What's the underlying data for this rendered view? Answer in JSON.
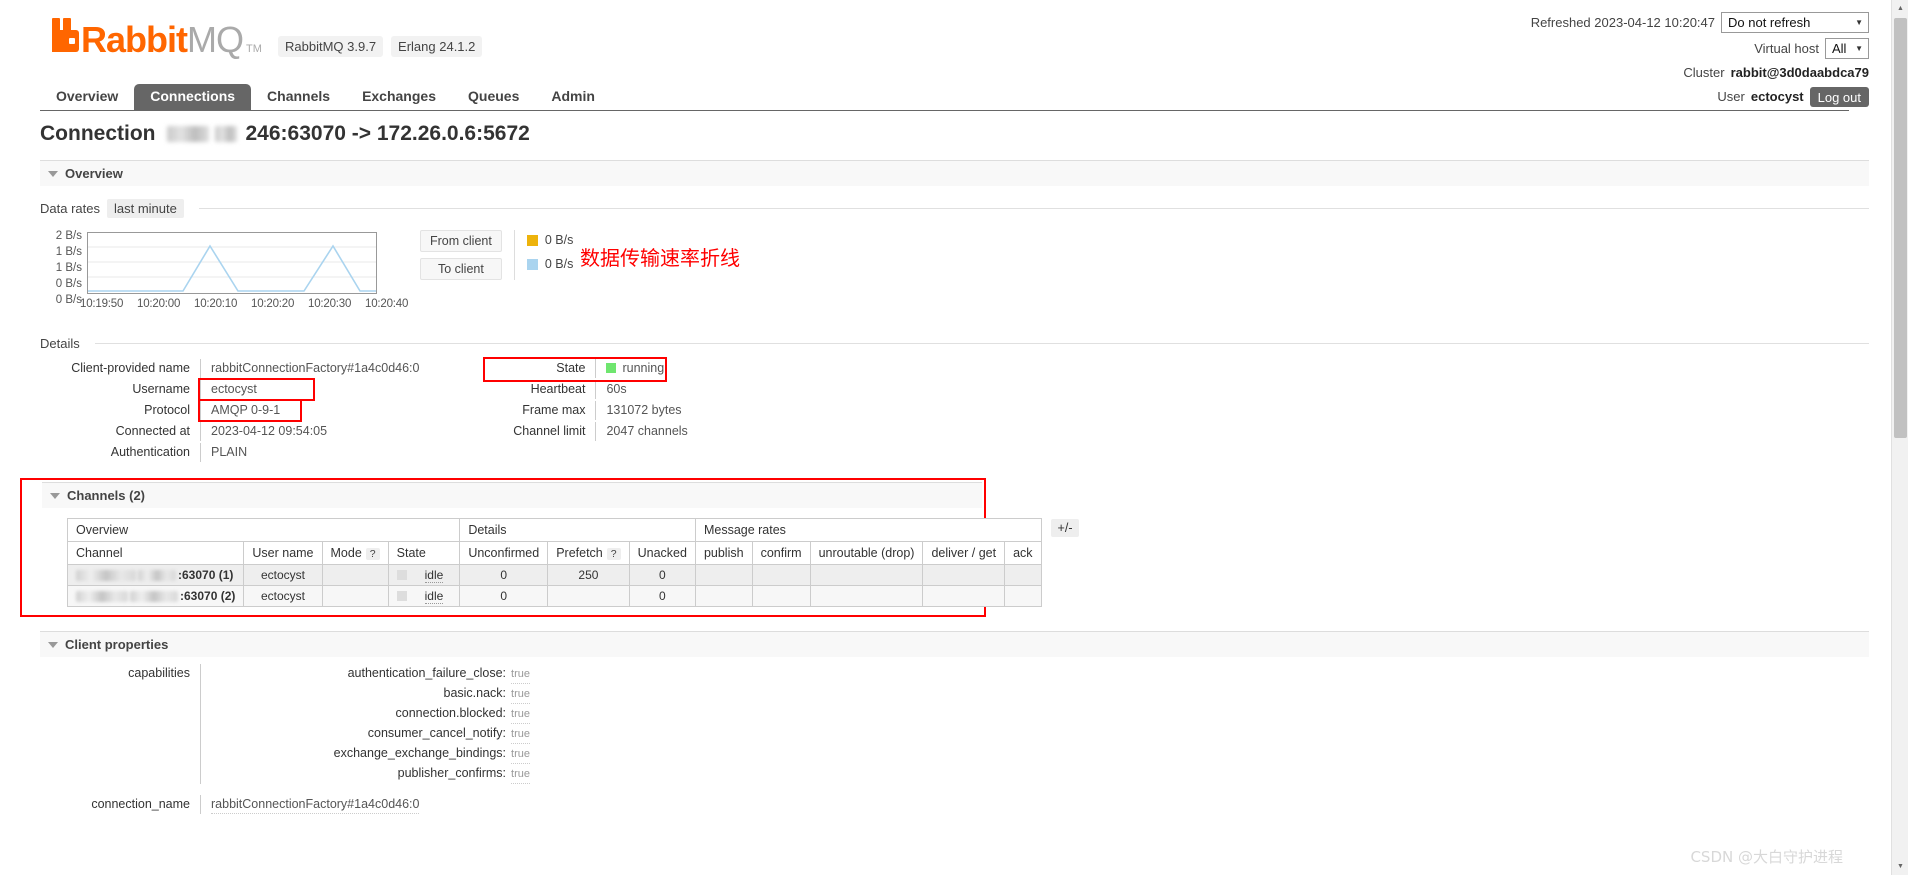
{
  "header": {
    "logo_rabbit": "Rabbit",
    "logo_mq": "MQ",
    "logo_tm": "TM",
    "version_rabbitmq": "RabbitMQ 3.9.7",
    "version_erlang": "Erlang 24.1.2",
    "refreshed_label": "Refreshed 2023-04-12 10:20:47",
    "refresh_option": "Do not refresh",
    "vhost_label": "Virtual host",
    "vhost_value": "All",
    "cluster_label": "Cluster",
    "cluster_value": "rabbit@3d0daabdca79",
    "user_label": "User",
    "user_value": "ectocyst",
    "logout_label": "Log out"
  },
  "nav": {
    "tabs": [
      {
        "label": "Overview",
        "active": false
      },
      {
        "label": "Connections",
        "active": true
      },
      {
        "label": "Channels",
        "active": false
      },
      {
        "label": "Exchanges",
        "active": false
      },
      {
        "label": "Queues",
        "active": false
      },
      {
        "label": "Admin",
        "active": false
      }
    ]
  },
  "page": {
    "title_prefix": "Connection",
    "title_suffix": "246:63070 -> 172.26.0.6:5672",
    "overview_section": "Overview",
    "data_rates_label": "Data rates",
    "data_rates_period": "last minute",
    "details_label": "Details",
    "annotation_cn": "数据传输速率折线",
    "watermark": "CSDN @大白守护进程"
  },
  "chart_data": {
    "type": "line",
    "title": "Data rates",
    "subtitle": "last minute",
    "xlabel": "",
    "ylabel": "B/s",
    "ytick_labels": [
      "2 B/s",
      "1 B/s",
      "1 B/s",
      "0 B/s",
      "0 B/s"
    ],
    "xtick_labels": [
      "10:19:50",
      "10:20:00",
      "10:20:10",
      "10:20:20",
      "10:20:30",
      "10:20:40"
    ],
    "ylim": [
      0,
      2
    ],
    "grid": true,
    "legend_position": "right",
    "series": [
      {
        "name": "From client",
        "color": "#edb30c",
        "current_value": "0 B/s",
        "x": [
          0,
          10,
          20,
          30,
          40,
          50,
          60
        ],
        "values": [
          0,
          0,
          0,
          0,
          0,
          0,
          0
        ]
      },
      {
        "name": "To client",
        "color": "#aad4ef",
        "current_value": "0 B/s",
        "x": [
          0,
          5,
          10,
          15,
          20,
          25,
          30,
          35,
          40,
          45,
          50,
          55,
          60
        ],
        "values": [
          0,
          0,
          0,
          0,
          1.3,
          0,
          0,
          0,
          0,
          0,
          1.3,
          0,
          0
        ]
      }
    ]
  },
  "details": {
    "left": [
      {
        "key": "Client-provided name",
        "value": "rabbitConnectionFactory#1a4c0d46:0",
        "highlight": false
      },
      {
        "key": "Username",
        "value": "ectocyst",
        "highlight": true
      },
      {
        "key": "Protocol",
        "value": "AMQP 0-9-1",
        "highlight": true
      },
      {
        "key": "Connected at",
        "value": "2023-04-12 09:54:05",
        "highlight": false
      },
      {
        "key": "Authentication",
        "value": "PLAIN",
        "highlight": false
      }
    ],
    "right": [
      {
        "key": "State",
        "value": "running",
        "highlight": true,
        "swatch": "#6fe66f"
      },
      {
        "key": "Heartbeat",
        "value": "60s",
        "highlight": false
      },
      {
        "key": "Frame max",
        "value": "131072 bytes",
        "highlight": false
      },
      {
        "key": "Channel limit",
        "value": "2047 channels",
        "highlight": false
      }
    ]
  },
  "channels": {
    "section_title": "Channels (2)",
    "group_headers": [
      {
        "label": "Overview",
        "span": 4
      },
      {
        "label": "Details",
        "span": 3
      },
      {
        "label": "Message rates",
        "span": 5
      }
    ],
    "columns": [
      "Channel",
      "User name",
      "Mode",
      "State",
      "Unconfirmed",
      "Prefetch",
      "Unacked",
      "publish",
      "confirm",
      "unroutable (drop)",
      "deliver / get",
      "ack"
    ],
    "help_columns": [
      "Mode",
      "Prefetch"
    ],
    "help_glyph": "?",
    "plus_minus": "+/-",
    "rows": [
      {
        "channel": ":63070 (1)",
        "user_name": "ectocyst",
        "mode": "",
        "state": "idle",
        "unconfirmed": "0",
        "prefetch": "250",
        "unacked": "0",
        "publish": "",
        "confirm": "",
        "unroutable": "",
        "deliver_get": "",
        "ack": ""
      },
      {
        "channel": ":63070 (2)",
        "user_name": "ectocyst",
        "mode": "",
        "state": "idle",
        "unconfirmed": "0",
        "prefetch": "",
        "unacked": "0",
        "publish": "",
        "confirm": "",
        "unroutable": "",
        "deliver_get": "",
        "ack": ""
      }
    ]
  },
  "client_properties": {
    "section_title": "Client properties",
    "capabilities_key": "capabilities",
    "capabilities": [
      {
        "name": "authentication_failure_close:",
        "value": "true"
      },
      {
        "name": "basic.nack:",
        "value": "true"
      },
      {
        "name": "connection.blocked:",
        "value": "true"
      },
      {
        "name": "consumer_cancel_notify:",
        "value": "true"
      },
      {
        "name": "exchange_exchange_bindings:",
        "value": "true"
      },
      {
        "name": "publisher_confirms:",
        "value": "true"
      }
    ],
    "connection_name_key": "connection_name",
    "connection_name_value": "rabbitConnectionFactory#1a4c0d46:0"
  }
}
